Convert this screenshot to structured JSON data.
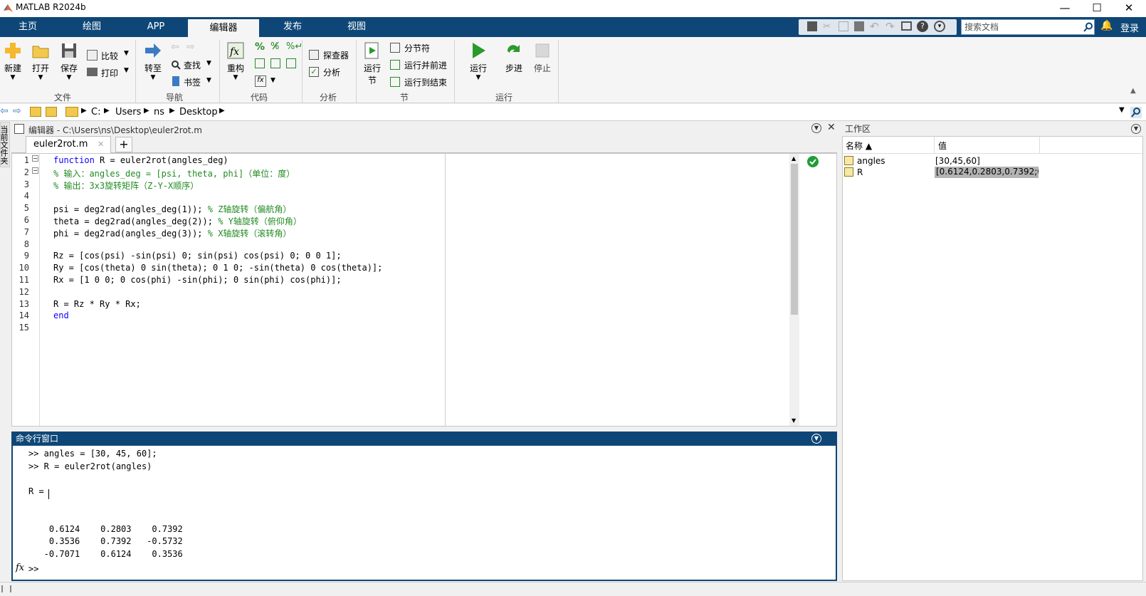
{
  "window": {
    "title": "MATLAB R2024b",
    "minimize": "—",
    "maximize": "☐",
    "close": "✕"
  },
  "tabs": [
    "主页",
    "绘图",
    "APP",
    "编辑器",
    "发布",
    "视图"
  ],
  "active_tab": "编辑器",
  "search": {
    "placeholder": "搜索文档"
  },
  "login": "登录",
  "ribbon": {
    "file": {
      "new": "新建",
      "open": "打开",
      "save": "保存",
      "compare": "比较",
      "print": "打印",
      "group": "文件"
    },
    "nav": {
      "goto": "转至",
      "find": "查找",
      "bookmark": "书签",
      "group": "导航"
    },
    "code": {
      "refactor": "重构",
      "group": "代码"
    },
    "analyze": {
      "explorer": "探查器",
      "analyze": "分析",
      "group": "分析"
    },
    "section": {
      "run_section_1": "运行",
      "run_section_2": "节",
      "section_break": "分节符",
      "run_and_advance": "运行并前进",
      "run_to_end": "运行到结束",
      "group": "节"
    },
    "run": {
      "run": "运行",
      "step": "步进",
      "stop": "停止",
      "group": "运行"
    }
  },
  "path": [
    "C:",
    "Users",
    "ns",
    "Desktop"
  ],
  "editor": {
    "header": "编辑器 - C:\\Users\\ns\\Desktop\\euler2rot.m",
    "file_tab": "euler2rot.m",
    "add_tab": "+",
    "line_numbers": [
      "1",
      "2",
      "3",
      "4",
      "5",
      "6",
      "7",
      "8",
      "9",
      "10",
      "11",
      "12",
      "13",
      "14",
      "15"
    ],
    "lines": [
      {
        "kw": "function",
        "text": " R = euler2rot(angles_deg)",
        "cm": ""
      },
      {
        "kw": "",
        "text": "",
        "cm": "% 输入：angles_deg = [psi, theta, phi]（单位：度）"
      },
      {
        "kw": "",
        "text": "",
        "cm": "% 输出：3x3旋转矩阵（Z-Y-X顺序）"
      },
      {
        "kw": "",
        "text": "",
        "cm": ""
      },
      {
        "kw": "",
        "text": "psi = deg2rad(angles_deg(1)); ",
        "cm": "% Z轴旋转（偏航角）"
      },
      {
        "kw": "",
        "text": "theta = deg2rad(angles_deg(2)); ",
        "cm": "% Y轴旋转（俯仰角）"
      },
      {
        "kw": "",
        "text": "phi = deg2rad(angles_deg(3)); ",
        "cm": "% X轴旋转（滚转角）"
      },
      {
        "kw": "",
        "text": "",
        "cm": ""
      },
      {
        "kw": "",
        "text": "Rz = [cos(psi) -sin(psi) 0; sin(psi) cos(psi) 0; 0 0 1];",
        "cm": ""
      },
      {
        "kw": "",
        "text": "Ry = [cos(theta) 0 sin(theta); 0 1 0; -sin(theta) 0 cos(theta)];",
        "cm": ""
      },
      {
        "kw": "",
        "text": "Rx = [1 0 0; 0 cos(phi) -sin(phi); 0 sin(phi) cos(phi)];",
        "cm": ""
      },
      {
        "kw": "",
        "text": "",
        "cm": ""
      },
      {
        "kw": "",
        "text": "R = Rz * Ry * Rx;",
        "cm": ""
      },
      {
        "kw": "end",
        "text": "",
        "cm": ""
      },
      {
        "kw": "",
        "text": "",
        "cm": ""
      }
    ]
  },
  "command": {
    "header": "命令行窗口",
    "lines": [
      ">> angles = [30, 45, 60];",
      ">> R = euler2rot(angles)",
      "",
      "R =",
      "",
      "",
      "    0.6124    0.2803    0.7392",
      "    0.3536    0.7392   -0.5732",
      "   -0.7071    0.6124    0.3536"
    ],
    "fx": "fx",
    "prompt": ">>"
  },
  "side_panel": "当前文件夹",
  "workspace": {
    "header": "工作区",
    "col_name": "名称 ▲",
    "col_value": "值",
    "rows": [
      {
        "name": "angles",
        "value": "[30,45,60]"
      },
      {
        "name": "R",
        "value": "[0.6124,0.2803,0.7392;0..."
      }
    ]
  },
  "colors": {
    "tab_bar": "#0e4777",
    "keyword": "#0e00ff",
    "comment": "#228b22"
  }
}
